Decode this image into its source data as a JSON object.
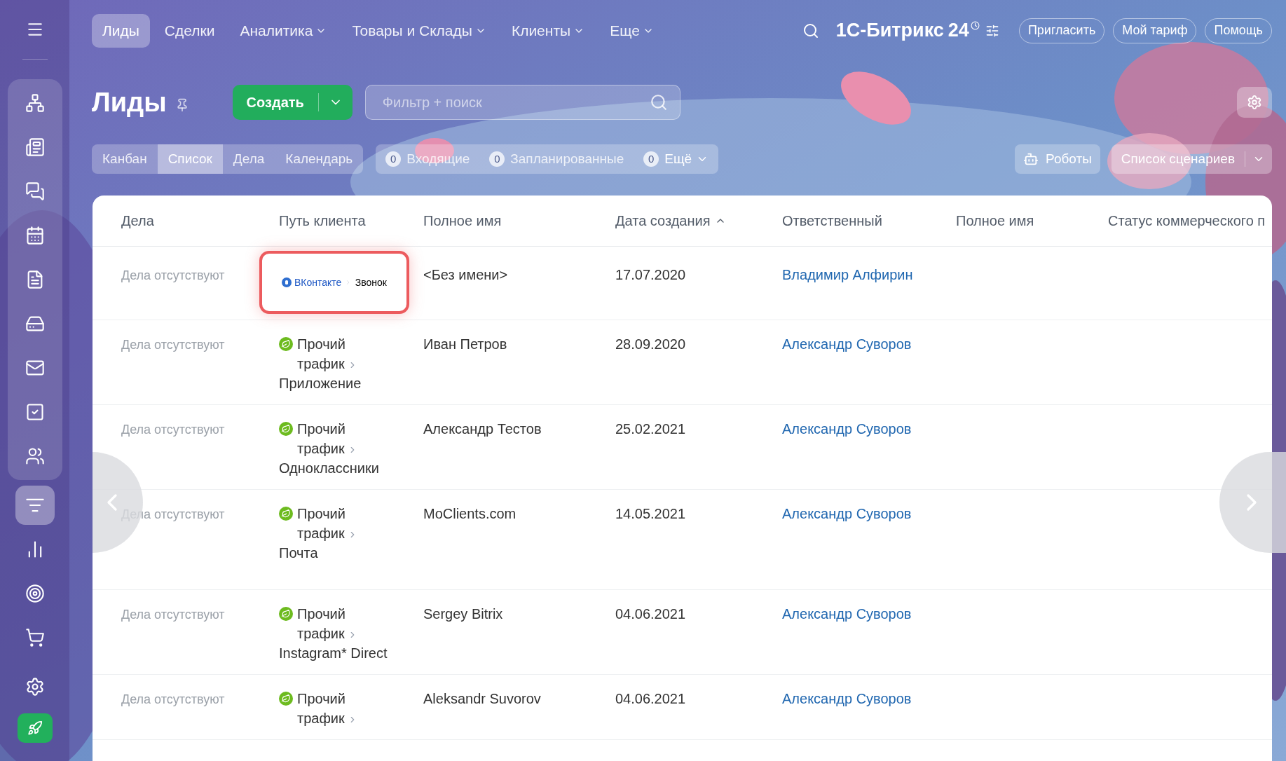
{
  "top_nav": {
    "items": [
      {
        "label": "Лиды",
        "selected": true,
        "dropdown": false
      },
      {
        "label": "Сделки",
        "selected": false,
        "dropdown": false
      },
      {
        "label": "Аналитика",
        "selected": false,
        "dropdown": true
      },
      {
        "label": "Товары и Склады",
        "selected": false,
        "dropdown": true
      },
      {
        "label": "Клиенты",
        "selected": false,
        "dropdown": true
      },
      {
        "label": "Еще",
        "selected": false,
        "dropdown": true
      }
    ],
    "logo": {
      "name": "1С-Битрикс",
      "number": "24"
    },
    "buttons": [
      "Пригласить",
      "Мой тариф",
      "Помощь"
    ]
  },
  "sidebar": {
    "items": [
      {
        "selected": false
      },
      {
        "selected": false
      },
      {
        "selected": false
      },
      {
        "selected": false
      },
      {
        "selected": false
      },
      {
        "selected": false
      },
      {
        "selected": false
      },
      {
        "selected": false
      },
      {
        "selected": false
      },
      {
        "selected": true
      },
      {
        "selected": false
      },
      {
        "selected": false
      },
      {
        "selected": false
      },
      {
        "selected": false
      }
    ]
  },
  "toolbar": {
    "title": "Лиды",
    "create_button": "Создать",
    "search": {
      "placeholder": "Фильтр + поиск"
    },
    "view_tabs": [
      {
        "label": "Канбан",
        "selected": false
      },
      {
        "label": "Список",
        "selected": true
      },
      {
        "label": "Дела",
        "selected": false
      },
      {
        "label": "Календарь",
        "selected": false
      }
    ],
    "counters": [
      {
        "count": "0",
        "label": "Входящие",
        "dropdown": false
      },
      {
        "count": "0",
        "label": "Запланированные",
        "dropdown": false
      },
      {
        "count": "0",
        "label": "Ещё",
        "dropdown": true
      }
    ],
    "robots_button": "Роботы",
    "scenarios_button": "Список сценариев"
  },
  "table": {
    "columns": [
      {
        "label": "Дела",
        "sorted": false
      },
      {
        "label": "Путь клиента",
        "sorted": false
      },
      {
        "label": "Полное имя",
        "sorted": false
      },
      {
        "label": "Дата создания",
        "sorted": true
      },
      {
        "label": "Ответственный",
        "sorted": false
      },
      {
        "label": "Полное имя",
        "sorted": false
      },
      {
        "label": "Статус коммерческого п",
        "sorted": false
      }
    ],
    "rows": [
      {
        "activities": "Дела отсутствуют",
        "path": {
          "kind": "vk",
          "source": "ВКонтакте",
          "step": "Звонок",
          "highlighted": true
        },
        "name": "<Без имени>",
        "created": "17.07.2020",
        "responsible": "Владимир Алфирин"
      },
      {
        "activities": "Дела отсутствуют",
        "path": {
          "kind": "other",
          "source": "Прочий трафик",
          "step": "Приложение"
        },
        "name": "Иван Петров",
        "created": "28.09.2020",
        "responsible": "Александр Суворов"
      },
      {
        "activities": "Дела отсутствуют",
        "path": {
          "kind": "other",
          "source": "Прочий трафик",
          "step": "Одноклассники"
        },
        "name": "Александр Тестов",
        "created": "25.02.2021",
        "responsible": "Александр Суворов"
      },
      {
        "activities": "Дела отсутствуют",
        "path": {
          "kind": "other",
          "source": "Прочий трафик",
          "step": "Почта"
        },
        "name": "MoClients.com",
        "created": "14.05.2021",
        "responsible": "Александр Суворов"
      },
      {
        "activities": "Дела отсутствуют",
        "path": {
          "kind": "other",
          "source": "Прочий трафик",
          "step": "Instagram* Direct"
        },
        "name": "Sergey Bitrix",
        "created": "04.06.2021",
        "responsible": "Александр Суворов"
      },
      {
        "activities": "Дела отсутствуют",
        "path": {
          "kind": "other",
          "source": "Прочий трафик"
        },
        "name": "Aleksandr Suvorov",
        "created": "04.06.2021",
        "responsible": "Александр Суворов"
      }
    ]
  }
}
